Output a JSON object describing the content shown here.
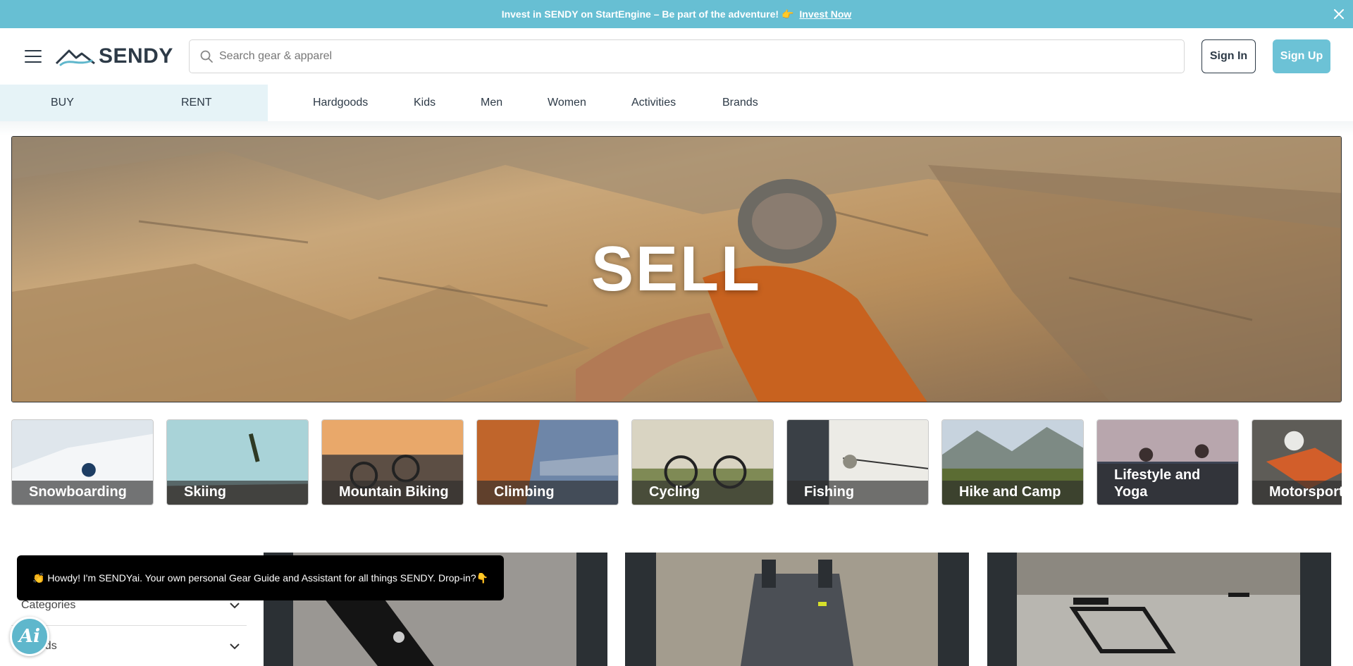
{
  "promo": {
    "text": "Invest in SENDY on StartEngine – Be part of the adventure! 👉",
    "link": "Invest Now"
  },
  "header": {
    "logo_text": "SENDY",
    "search_placeholder": "Search gear & apparel",
    "sign_in": "Sign In",
    "sign_up": "Sign Up"
  },
  "nav": {
    "modes": [
      "BUY",
      "RENT"
    ],
    "categories": [
      "Hardgoods",
      "Kids",
      "Men",
      "Women",
      "Activities",
      "Brands"
    ]
  },
  "hero": {
    "title": "SELL"
  },
  "activities": [
    {
      "label": "Snowboarding"
    },
    {
      "label": "Skiing"
    },
    {
      "label": "Mountain Biking"
    },
    {
      "label": "Climbing"
    },
    {
      "label": "Cycling"
    },
    {
      "label": "Fishing"
    },
    {
      "label": "Hike and Camp"
    },
    {
      "label": "Lifestyle and Yoga"
    },
    {
      "label": "Motorsports"
    }
  ],
  "filters": {
    "categories": "Categories",
    "brands": "Brands"
  },
  "chat": {
    "message": "👏 Howdy! I'm SENDYai. Your own personal Gear Guide and Assistant for all things SENDY. Drop-in?👇",
    "button_label": "Ai"
  },
  "colors": {
    "accent": "#67bfd3",
    "brand_dark": "#2d3a47"
  }
}
